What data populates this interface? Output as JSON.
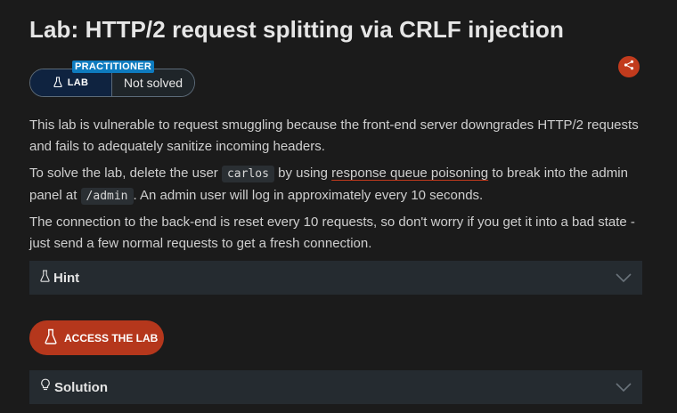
{
  "title": "Lab: HTTP/2 request splitting via CRLF injection",
  "badge": {
    "level": "PRACTITIONER",
    "type": "LAB",
    "status": "Not solved"
  },
  "description": {
    "p1": "This lab is vulnerable to request smuggling because the front-end server downgrades HTTP/2 requests and fails to adequately sanitize incoming headers.",
    "p2_a": "To solve the lab, delete the user ",
    "p2_code1": "carlos",
    "p2_b": " by using ",
    "p2_link": "response queue poisoning",
    "p2_c": " to break into the admin panel at ",
    "p2_code2": "/admin",
    "p2_d": ". An admin user will log in approximately every 10 seconds.",
    "p3": "The connection to the back-end is reset every 10 requests, so don't worry if you get it into a bad state - just send a few normal requests to get a fresh connection."
  },
  "hint": {
    "label": "Hint"
  },
  "access_button": {
    "label": "ACCESS THE LAB"
  },
  "solution": {
    "label": "Solution"
  },
  "icons": {
    "share": "share-icon",
    "flask": "flask-icon",
    "bulb": "lightbulb-icon",
    "chevron": "chevron-down-icon"
  },
  "colors": {
    "accent": "#c23b1d",
    "level_badge": "#0e7bbf",
    "lab_badge": "#0f2340",
    "background": "#1b1b1b"
  }
}
